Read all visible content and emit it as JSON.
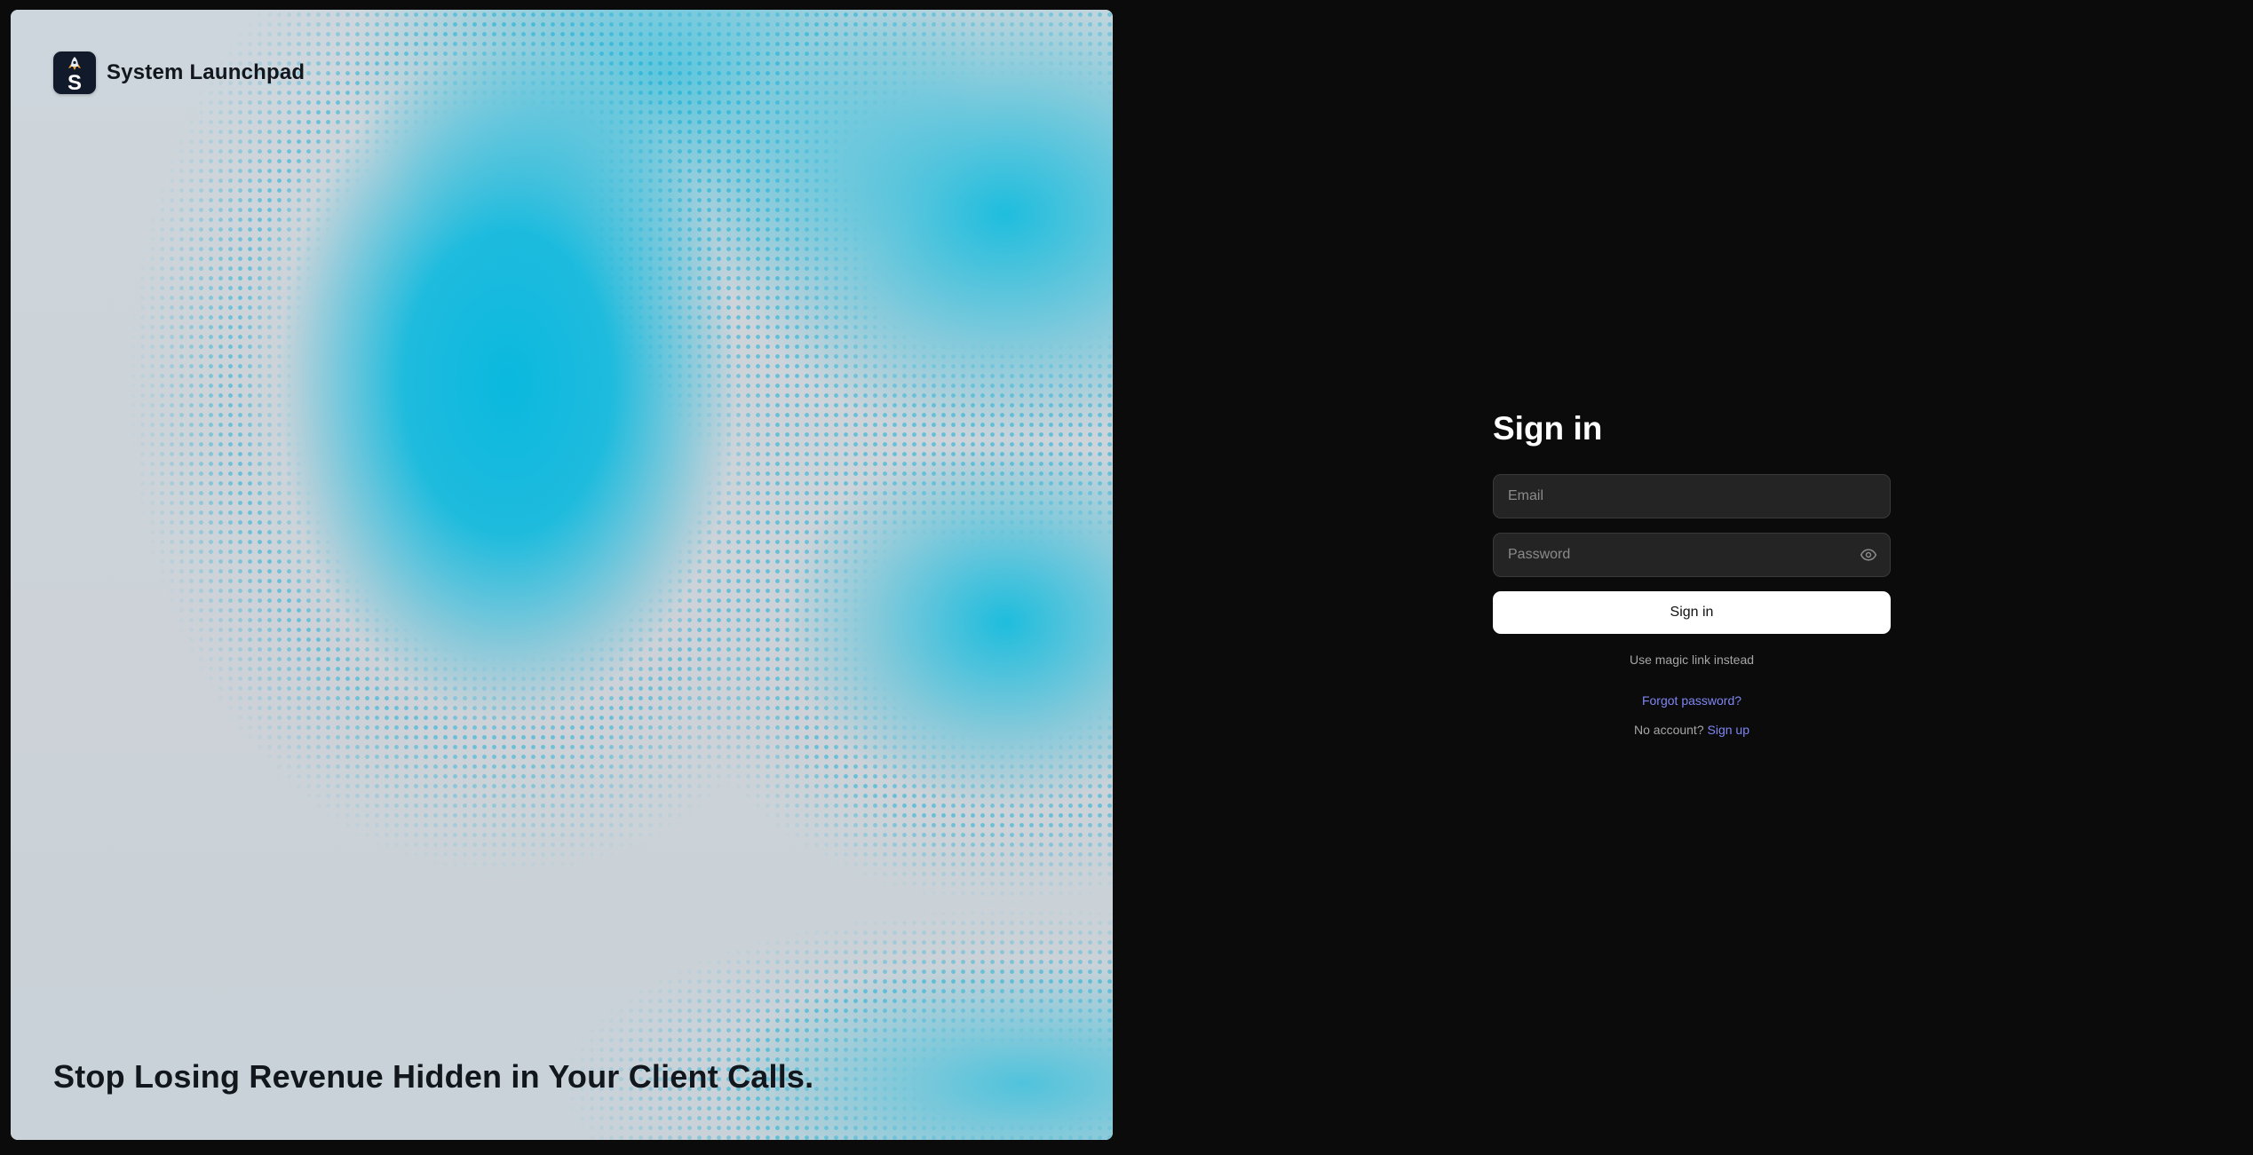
{
  "brand": {
    "name": "System Launchpad",
    "logo_icon": "rocket-s-logo-icon",
    "logo_letter": "S"
  },
  "hero": {
    "tagline": "Stop Losing Revenue Hidden in Your Client Calls.",
    "accent_color": "#00b7de"
  },
  "signin": {
    "title": "Sign in",
    "email_placeholder": "Email",
    "email_value": "",
    "password_placeholder": "Password",
    "password_value": "",
    "show_password_icon": "eye-icon",
    "submit_label": "Sign in",
    "magic_link_label": "Use magic link instead",
    "forgot_password_label": "Forgot password?",
    "no_account_text": "No account?",
    "signup_label": "Sign up",
    "link_color": "#7f86f2"
  }
}
